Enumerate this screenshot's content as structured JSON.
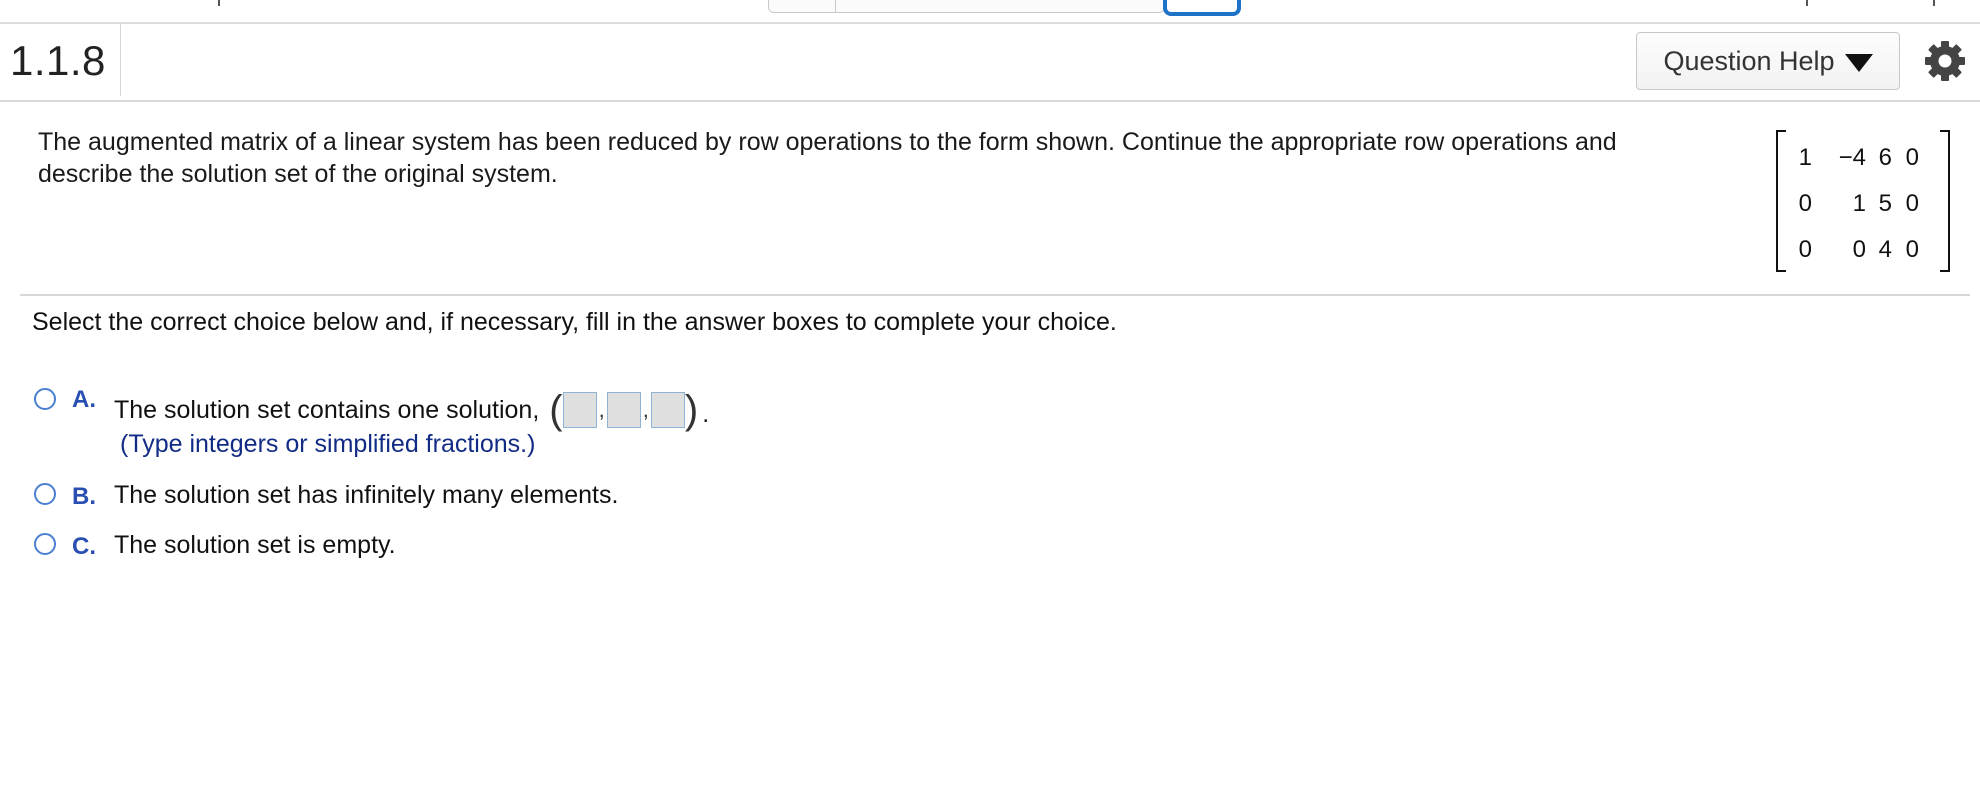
{
  "question": {
    "number": "1.1.8",
    "help_label": "Question Help",
    "text": "The augmented matrix of a linear system has been reduced by row operations to the form shown. Continue the appropriate row operations and describe the solution set of the original system.",
    "matrix": [
      [
        "1",
        "−4",
        "6",
        "0"
      ],
      [
        "0",
        "1",
        "5",
        "0"
      ],
      [
        "0",
        "0",
        "4",
        "0"
      ]
    ]
  },
  "instructions": "Select the correct choice below and, if necessary, fill in the answer boxes to complete your choice.",
  "choices": [
    {
      "letter": "A.",
      "text": "The solution set contains one solution,",
      "hint": "(Type integers or simplified fractions.)",
      "answer_boxes": [
        "",
        "",
        ""
      ]
    },
    {
      "letter": "B.",
      "text": "The solution set has infinitely many elements."
    },
    {
      "letter": "C.",
      "text": "The solution set is empty."
    }
  ],
  "colors": {
    "accent": "#2a4fb3",
    "radio": "#4a7fd1",
    "hint": "#122c86",
    "focus": "#1e73c8"
  }
}
